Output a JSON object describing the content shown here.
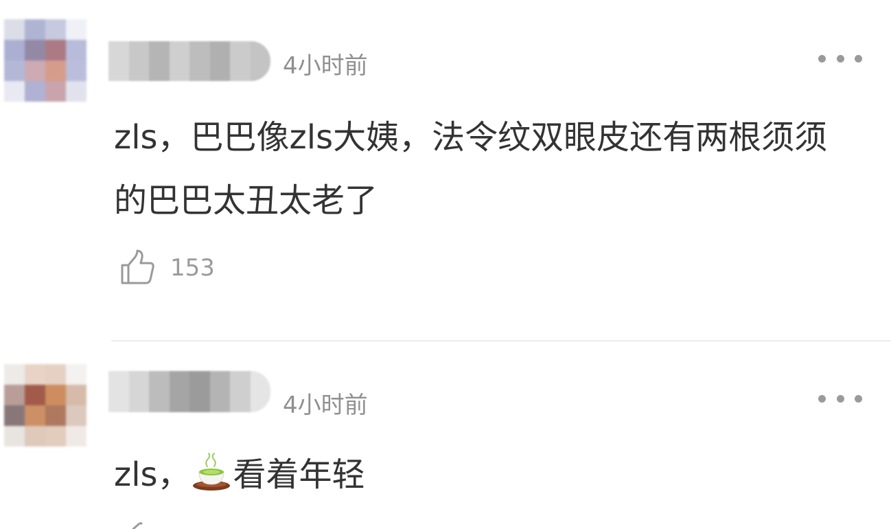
{
  "comments": [
    {
      "time": "4小时前",
      "text": "zls，巴巴像zls大姨，法令纹双眼皮还有两根须须的巴巴太丑太老了",
      "likes": "153"
    },
    {
      "time": "4小时前",
      "text_before_emoji": "zls，",
      "emoji": "tea-cup-icon",
      "text_after_emoji": "看着年轻"
    }
  ],
  "colors": {
    "text": "#333333",
    "meta": "#8f8f8f",
    "divider": "#ececec",
    "background": "#ffffff"
  }
}
